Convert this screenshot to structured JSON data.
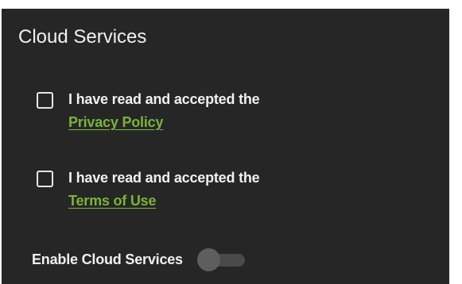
{
  "dialog": {
    "title": "Cloud Services"
  },
  "consents": [
    {
      "label": "I have read and accepted the",
      "link": "Privacy Policy",
      "checked": false
    },
    {
      "label": "I have read and accepted the",
      "link": "Terms of Use",
      "checked": false
    }
  ],
  "enable": {
    "label": "Enable Cloud Services",
    "on": false
  },
  "colors": {
    "panel_background": "#262626",
    "text": "#f0f0f0",
    "link": "#7ab33c",
    "toggle_track": "#4a4a4a",
    "toggle_thumb": "#5e5e5e"
  }
}
